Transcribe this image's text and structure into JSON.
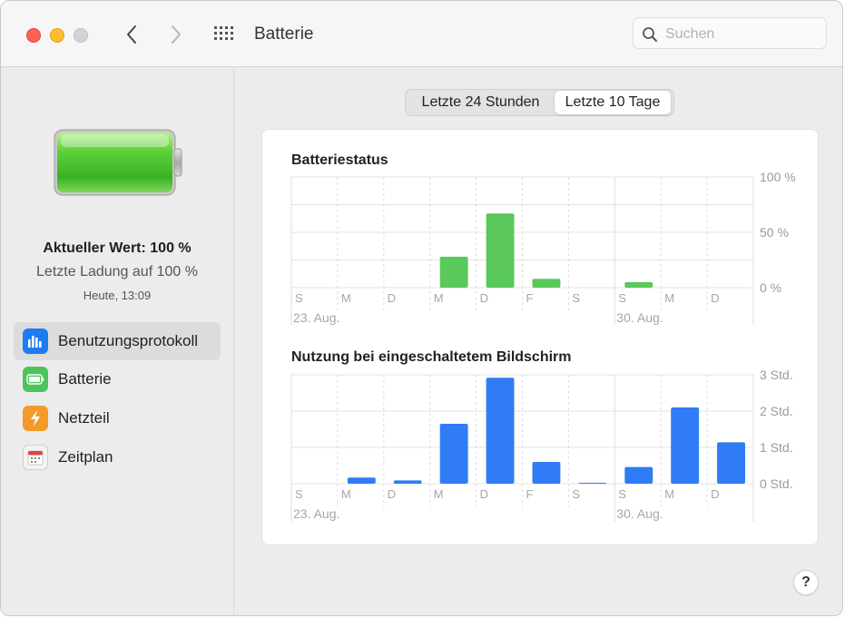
{
  "window": {
    "title": "Batterie",
    "search_placeholder": "Suchen"
  },
  "sidebar": {
    "current_value": "Aktueller Wert: 100 %",
    "last_charge": "Letzte Ladung auf 100 %",
    "timestamp": "Heute, 13:09",
    "items": [
      {
        "label": "Benutzungsprotokoll",
        "icon": "usage-chart-icon",
        "color": "#1e7cf2",
        "selected": true
      },
      {
        "label": "Batterie",
        "icon": "battery-icon",
        "color": "#4cc45a",
        "selected": false
      },
      {
        "label": "Netzteil",
        "icon": "lightning-icon",
        "color": "#f39a2b",
        "selected": false
      },
      {
        "label": "Zeitplan",
        "icon": "calendar-icon",
        "color": "#e8e8e8",
        "selected": false
      }
    ]
  },
  "segmented": {
    "options": [
      "Letzte 24 Stunden",
      "Letzte 10 Tage"
    ],
    "selected_index": 1
  },
  "help_label": "?",
  "chart_data": [
    {
      "type": "bar",
      "title": "Batteriestatus",
      "categories": [
        "S",
        "M",
        "D",
        "M",
        "D",
        "F",
        "S",
        "S",
        "M",
        "D"
      ],
      "date_labels": [
        {
          "index": 0,
          "text": "23. Aug."
        },
        {
          "index": 7,
          "text": "30. Aug."
        }
      ],
      "values": [
        0,
        0,
        0,
        28,
        67,
        8,
        0,
        5,
        0,
        0
      ],
      "ylim": [
        0,
        100
      ],
      "yticks": [
        {
          "value": 100,
          "label": "100 %"
        },
        {
          "value": 50,
          "label": "50 %"
        },
        {
          "value": 0,
          "label": "0 %"
        }
      ],
      "color": "#5ac85a",
      "grid": true
    },
    {
      "type": "bar",
      "title": "Nutzung bei eingeschaltetem Bildschirm",
      "categories": [
        "S",
        "M",
        "D",
        "M",
        "D",
        "F",
        "S",
        "S",
        "M",
        "D"
      ],
      "date_labels": [
        {
          "index": 0,
          "text": "23. Aug."
        },
        {
          "index": 7,
          "text": "30. Aug."
        }
      ],
      "values": [
        0,
        0.17,
        0.09,
        1.65,
        2.92,
        0.6,
        0.02,
        0.46,
        2.1,
        1.14
      ],
      "ylim": [
        0,
        3
      ],
      "yticks": [
        {
          "value": 3,
          "label": "3 Std."
        },
        {
          "value": 2,
          "label": "2 Std."
        },
        {
          "value": 1,
          "label": "1 Std."
        },
        {
          "value": 0,
          "label": "0 Std."
        }
      ],
      "color": "#2f7cf6",
      "grid": true
    }
  ]
}
